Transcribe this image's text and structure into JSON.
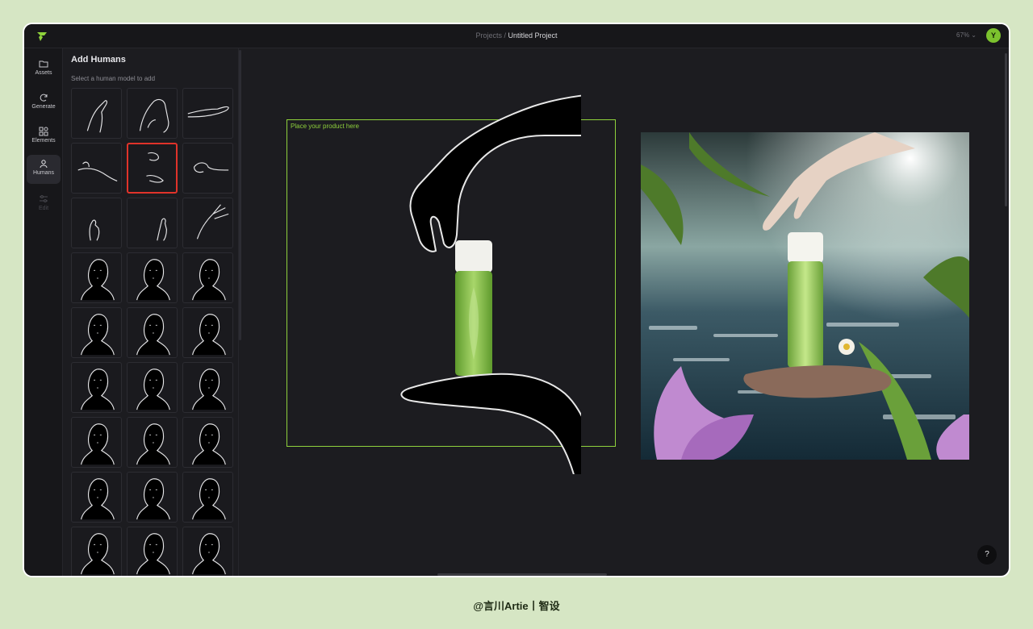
{
  "breadcrumb": {
    "root": "Projects",
    "separator": " / ",
    "current": "Untitled Project"
  },
  "zoom": {
    "level": "67%"
  },
  "user": {
    "initial": "Y"
  },
  "rail": {
    "items": [
      {
        "label": "Assets",
        "icon": "folder-icon"
      },
      {
        "label": "Generate",
        "icon": "refresh-icon"
      },
      {
        "label": "Elements",
        "icon": "shapes-icon"
      },
      {
        "label": "Humans",
        "icon": "person-icon"
      },
      {
        "label": "Edit",
        "icon": "sliders-icon"
      }
    ]
  },
  "panel": {
    "title": "Add Humans",
    "subtitle": "Select a human model to add"
  },
  "canvas": {
    "placeholder": "Place your product here"
  },
  "help": {
    "label": "?"
  },
  "caption": "@言川Artie丨智设",
  "colors": {
    "accent": "#8fd23c",
    "selected": "#e0332a",
    "background": "#d6e6c4"
  }
}
